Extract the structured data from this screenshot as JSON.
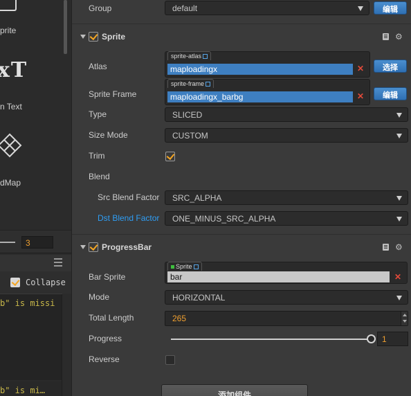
{
  "left_panel": {
    "items": [
      {
        "label": "prite"
      },
      {
        "label": "n Text",
        "glyph": "xT"
      },
      {
        "label": "dMap"
      }
    ],
    "zoom_value": "3",
    "console": {
      "collapse_label": "Collapse",
      "collapse_checked": true,
      "logs": [
        "b\" is missi",
        "b\" is mi…"
      ]
    }
  },
  "inspector": {
    "group": {
      "label": "Group",
      "value": "default",
      "edit_label": "编辑"
    },
    "sprite": {
      "title": "Sprite",
      "enabled": true,
      "atlas": {
        "label": "Atlas",
        "tag": "sprite-atlas",
        "value": "maploadingx",
        "select_label": "选择"
      },
      "sprite_frame": {
        "label": "Sprite Frame",
        "tag": "sprite-frame",
        "value": "maploadingx_barbg",
        "edit_label": "编辑"
      },
      "type": {
        "label": "Type",
        "value": "SLICED"
      },
      "size_mode": {
        "label": "Size Mode",
        "value": "CUSTOM"
      },
      "trim": {
        "label": "Trim",
        "checked": true
      },
      "blend": {
        "label": "Blend"
      },
      "src_blend": {
        "label": "Src Blend Factor",
        "value": "SRC_ALPHA"
      },
      "dst_blend": {
        "label": "Dst Blend Factor",
        "value": "ONE_MINUS_SRC_ALPHA"
      }
    },
    "progress_bar": {
      "title": "ProgressBar",
      "enabled": true,
      "bar_sprite": {
        "label": "Bar Sprite",
        "tag": "Sprite",
        "value": "bar"
      },
      "mode": {
        "label": "Mode",
        "value": "HORIZONTAL"
      },
      "total_length": {
        "label": "Total Length",
        "value": "265"
      },
      "progress": {
        "label": "Progress",
        "value": "1",
        "fraction": 1
      },
      "reverse": {
        "label": "Reverse",
        "checked": false
      }
    },
    "add_component_label": "添加组件"
  },
  "colors": {
    "accent_orange": "#f5a623",
    "button_blue": "#3e7fc1",
    "clear_red": "#e24a3a",
    "label_blue": "#2f9ef5"
  }
}
